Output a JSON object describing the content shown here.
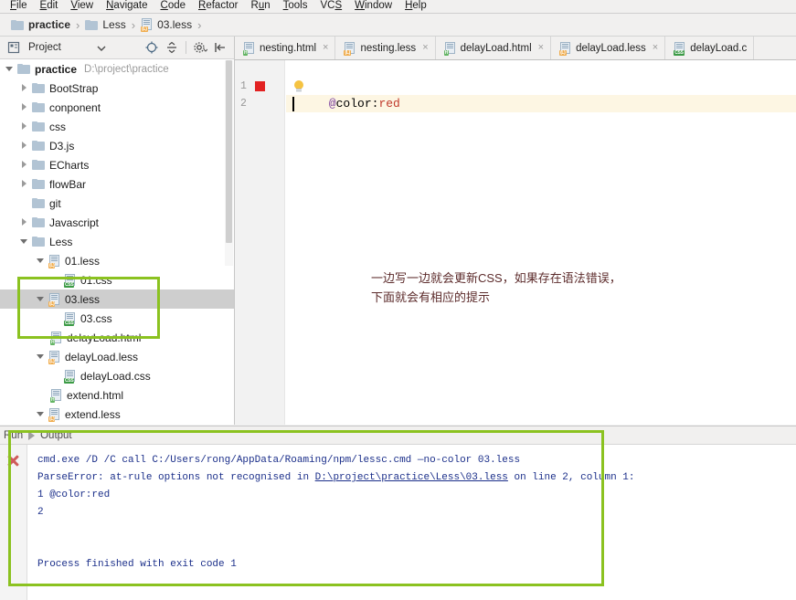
{
  "menubar": {
    "items": [
      {
        "pre": "",
        "mn": "F",
        "post": "ile"
      },
      {
        "pre": "",
        "mn": "E",
        "post": "dit"
      },
      {
        "pre": "",
        "mn": "V",
        "post": "iew"
      },
      {
        "pre": "",
        "mn": "N",
        "post": "avigate"
      },
      {
        "pre": "",
        "mn": "C",
        "post": "ode"
      },
      {
        "pre": "",
        "mn": "R",
        "post": "efactor"
      },
      {
        "pre": "R",
        "mn": "u",
        "post": "n"
      },
      {
        "pre": "",
        "mn": "T",
        "post": "ools"
      },
      {
        "pre": "VC",
        "mn": "S",
        "post": ""
      },
      {
        "pre": "",
        "mn": "W",
        "post": "indow"
      },
      {
        "pre": "",
        "mn": "H",
        "post": "elp"
      }
    ]
  },
  "breadcrumb": {
    "items": [
      {
        "label": "practice",
        "icon": "folder-icon",
        "bold": true
      },
      {
        "label": "Less",
        "icon": "folder-icon",
        "bold": false
      },
      {
        "label": "03.less",
        "icon": "less-file-icon",
        "bold": false
      }
    ],
    "separator": "›"
  },
  "tool_window": {
    "title": "Project",
    "icons": [
      "project-view-icon",
      "chevron-down-icon",
      "locate-icon",
      "collapse-all-icon",
      "settings-gear-icon",
      "hide-icon"
    ]
  },
  "tabs": [
    {
      "label": "nesting.html",
      "icon": "html-file-icon",
      "close": "×"
    },
    {
      "label": "nesting.less",
      "icon": "less-file-icon",
      "close": "×"
    },
    {
      "label": "delayLoad.html",
      "icon": "html-file-icon",
      "close": "×"
    },
    {
      "label": "delayLoad.less",
      "icon": "less-file-icon",
      "close": "×"
    },
    {
      "label": "delayLoad.c",
      "icon": "css-file-icon",
      "close": ""
    }
  ],
  "tree": {
    "root": {
      "label": "practice",
      "path": "D:\\project\\practice"
    },
    "nodes": [
      {
        "label": "practice",
        "sub": "D:\\project\\practice",
        "indent": 0,
        "arrow": "open",
        "icon": "folder-icon",
        "bold": true,
        "selected": false
      },
      {
        "label": "BootStrap",
        "sub": "",
        "indent": 1,
        "arrow": "closed",
        "icon": "folder-icon",
        "bold": false,
        "selected": false
      },
      {
        "label": "conponent",
        "sub": "",
        "indent": 1,
        "arrow": "closed",
        "icon": "folder-icon",
        "bold": false,
        "selected": false
      },
      {
        "label": "css",
        "sub": "",
        "indent": 1,
        "arrow": "closed",
        "icon": "folder-icon",
        "bold": false,
        "selected": false
      },
      {
        "label": "D3.js",
        "sub": "",
        "indent": 1,
        "arrow": "closed",
        "icon": "folder-icon",
        "bold": false,
        "selected": false
      },
      {
        "label": "ECharts",
        "sub": "",
        "indent": 1,
        "arrow": "closed",
        "icon": "folder-icon",
        "bold": false,
        "selected": false
      },
      {
        "label": "flowBar",
        "sub": "",
        "indent": 1,
        "arrow": "closed",
        "icon": "folder-icon",
        "bold": false,
        "selected": false
      },
      {
        "label": "git",
        "sub": "",
        "indent": 1,
        "arrow": "none",
        "icon": "folder-icon",
        "bold": false,
        "selected": false
      },
      {
        "label": "Javascript",
        "sub": "",
        "indent": 1,
        "arrow": "closed",
        "icon": "folder-icon",
        "bold": false,
        "selected": false
      },
      {
        "label": "Less",
        "sub": "",
        "indent": 1,
        "arrow": "open",
        "icon": "folder-icon",
        "bold": false,
        "selected": false
      },
      {
        "label": "01.less",
        "sub": "",
        "indent": 2,
        "arrow": "open",
        "icon": "less-file-icon",
        "bold": false,
        "selected": false
      },
      {
        "label": "01.css",
        "sub": "",
        "indent": 3,
        "arrow": "none",
        "icon": "css-file-icon",
        "bold": false,
        "selected": false
      },
      {
        "label": "03.less",
        "sub": "",
        "indent": 2,
        "arrow": "open",
        "icon": "less-file-icon",
        "bold": false,
        "selected": true
      },
      {
        "label": "03.css",
        "sub": "",
        "indent": 3,
        "arrow": "none",
        "icon": "css-file-icon",
        "bold": false,
        "selected": false
      },
      {
        "label": "delayLoad.html",
        "sub": "",
        "indent": 2,
        "arrow": "none",
        "icon": "html-file-icon",
        "bold": false,
        "selected": false
      },
      {
        "label": "delayLoad.less",
        "sub": "",
        "indent": 2,
        "arrow": "open",
        "icon": "less-file-icon",
        "bold": false,
        "selected": false
      },
      {
        "label": "delayLoad.css",
        "sub": "",
        "indent": 3,
        "arrow": "none",
        "icon": "css-file-icon",
        "bold": false,
        "selected": false
      },
      {
        "label": "extend.html",
        "sub": "",
        "indent": 2,
        "arrow": "none",
        "icon": "html-file-icon",
        "bold": false,
        "selected": false
      },
      {
        "label": "extend.less",
        "sub": "",
        "indent": 2,
        "arrow": "open",
        "icon": "less-file-icon",
        "bold": false,
        "selected": false
      }
    ]
  },
  "editor": {
    "line_numbers": [
      "1",
      "2"
    ],
    "code": {
      "at": "@",
      "prop": "color",
      "colon": ":",
      "value": "red"
    },
    "full_line": "@color:red",
    "annotation_line1": "一边写一边就会更新CSS，如果存在语法错误，",
    "annotation_line2": "下面就会有相应的提示"
  },
  "run_panel": {
    "tab_run": "Run",
    "tab_output": "Output",
    "lines": [
      {
        "pre": "cmd.exe /D /C call C:/Users/rong/AppData/Roaming/npm/lessc.cmd —no-color 03.less",
        "link": "",
        "post": ""
      },
      {
        "pre": "ParseError: at-rule options not recognised in ",
        "link": "D:\\project\\practice\\Less\\03.less",
        "post": " on line 2, column 1:"
      },
      {
        "pre": "1 @color:red",
        "link": "",
        "post": ""
      },
      {
        "pre": "2",
        "link": "",
        "post": ""
      },
      {
        "pre": "",
        "link": "",
        "post": ""
      },
      {
        "pre": "",
        "link": "",
        "post": ""
      },
      {
        "pre": "Process finished with exit code 1",
        "link": "",
        "post": ""
      }
    ]
  },
  "colors": {
    "highlight_green": "#8bc220",
    "error_red": "#e22222",
    "selection_gray": "#cecece",
    "annotation_text": "#5c2b2b",
    "console_text": "#1b2f8a"
  }
}
